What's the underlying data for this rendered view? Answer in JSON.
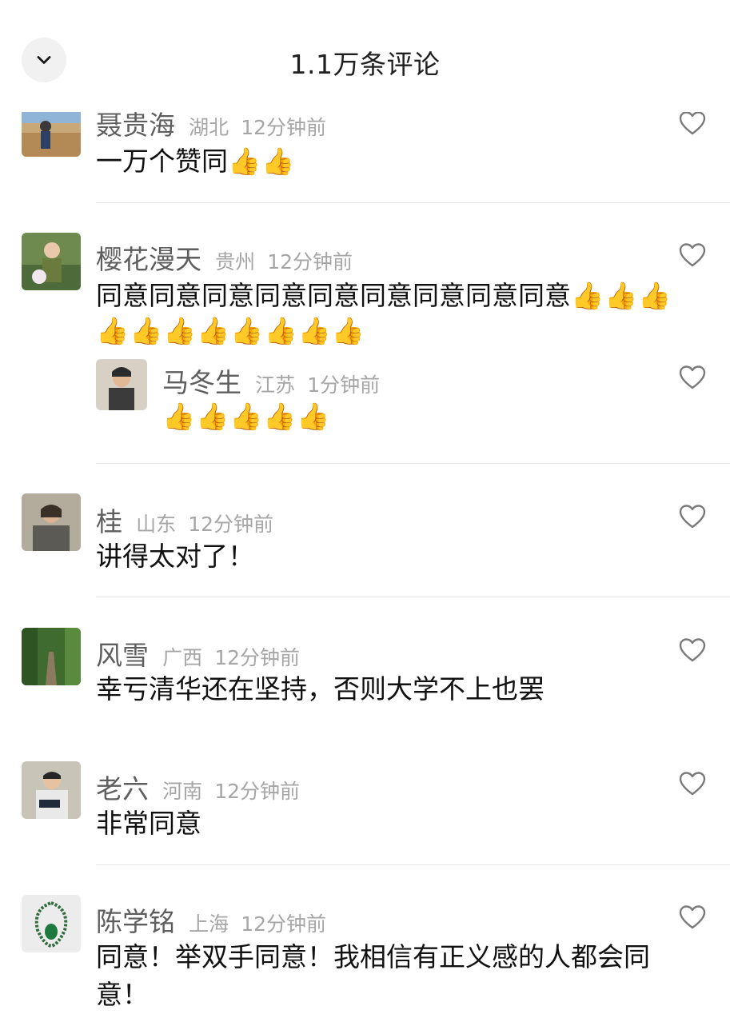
{
  "header": {
    "title": "1.1万条评论",
    "back_icon": "chevron-down-icon"
  },
  "comments": [
    {
      "name": "聂贵海",
      "region": "湖北",
      "time": "12分钟前",
      "text": "一万个赞同",
      "thumbs": "👍👍"
    },
    {
      "name": "樱花漫天",
      "region": "贵州",
      "time": "12分钟前",
      "text": "同意同意同意同意同意同意同意同意同意",
      "thumbs": "👍👍👍",
      "thumbs2": "👍👍👍👍👍👍👍👍",
      "reply": {
        "name": "马冬生",
        "region": "江苏",
        "time": "1分钟前",
        "thumbs": "👍👍👍👍👍"
      }
    },
    {
      "name": "桂",
      "region": "山东",
      "time": "12分钟前",
      "text": "讲得太对了！"
    },
    {
      "name": "风雪",
      "region": "广西",
      "time": "12分钟前",
      "text": "幸亏清华还在坚持，否则大学不上也罢"
    },
    {
      "name": "老六",
      "region": "河南",
      "time": "12分钟前",
      "text": "非常同意"
    },
    {
      "name": "陈学铭",
      "region": "上海",
      "time": "12分钟前",
      "text": "同意！举双手同意！我相信有正义感的人都会同",
      "text2": "意！"
    }
  ],
  "icons": {
    "like": "heart-outline-icon",
    "thumb": "thumbs-up-icon"
  },
  "colors": {
    "username": "#5e5e5e",
    "meta": "#a6a6a6",
    "text": "#111111",
    "divider": "#e7e7e7"
  }
}
